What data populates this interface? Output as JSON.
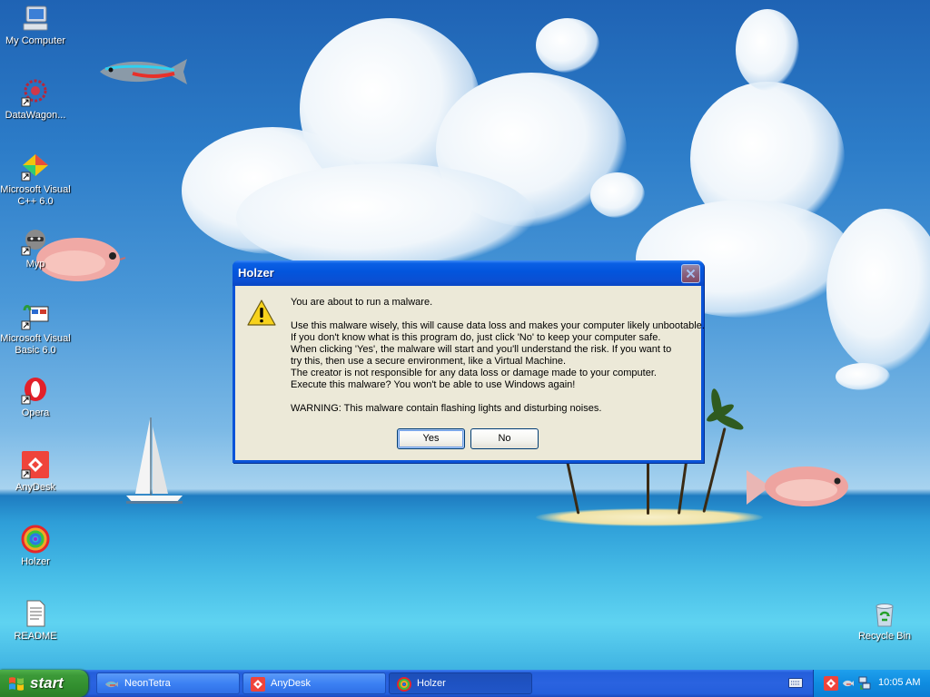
{
  "desktop": {
    "icons": [
      {
        "label": "My Computer",
        "icon": "my-computer-icon"
      },
      {
        "label": "DataWagon...",
        "icon": "datawagon-icon"
      },
      {
        "label": "Microsoft Visual C++ 6.0",
        "icon": "visual-cpp-icon"
      },
      {
        "label": "Myp",
        "icon": "raccoon-icon"
      },
      {
        "label": "Microsoft Visual Basic 6.0",
        "icon": "visual-basic-icon"
      },
      {
        "label": "Opera",
        "icon": "opera-icon"
      },
      {
        "label": "AnyDesk",
        "icon": "anydesk-icon"
      },
      {
        "label": "Holzer",
        "icon": "holzer-icon"
      },
      {
        "label": "README",
        "icon": "text-document-icon"
      },
      {
        "label": "Recycle Bin",
        "icon": "recycle-bin-icon"
      }
    ]
  },
  "dialog": {
    "title": "Holzer",
    "icon": "warning-icon",
    "lines": [
      "You are about to run a malware.",
      "",
      "Use this malware wisely, this will cause data loss and makes your computer likely unbootable.",
      "If you don't know what is this program do, just click 'No' to keep your computer safe.",
      "When clicking 'Yes', the malware will start and you'll understand the risk. If you want to",
      "try this, then use a secure environment, like a Virtual Machine.",
      "The creator is not responsible for any data loss or damage made to your computer.",
      "Execute this malware? You won't be able to use Windows again!",
      "",
      "WARNING: This malware contain flashing lights and disturbing noises."
    ],
    "yes_label": "Yes",
    "no_label": "No"
  },
  "taskbar": {
    "start_label": "start",
    "buttons": [
      {
        "label": "NeonTetra",
        "icon": "fish-icon",
        "active": false
      },
      {
        "label": "AnyDesk",
        "icon": "anydesk-icon",
        "active": false
      },
      {
        "label": "Holzer",
        "icon": "holzer-icon",
        "active": true
      }
    ],
    "clock": "10:05 AM"
  },
  "colors": {
    "taskbar_blue": "#245edb",
    "start_green": "#3c9a38",
    "dialog_face": "#ece9d8",
    "title_blue": "#0355dc"
  }
}
